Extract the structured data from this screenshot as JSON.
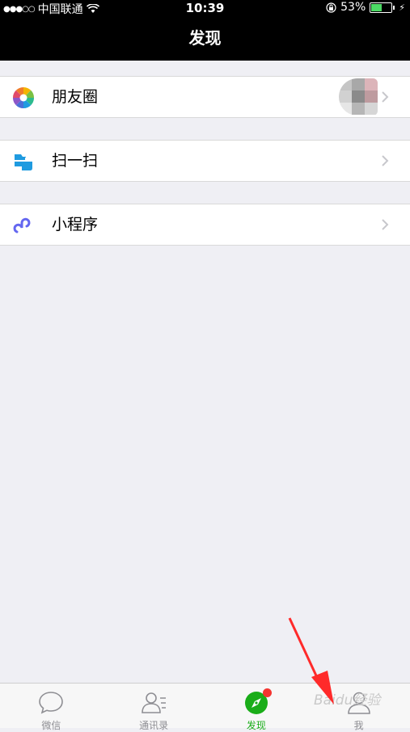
{
  "status": {
    "carrier": "中国联通",
    "time": "10:39",
    "battery_percent": "53%",
    "battery_level": 0.53
  },
  "nav": {
    "title": "发现"
  },
  "menu": {
    "moments": "朋友圈",
    "scan": "扫一扫",
    "mini_programs": "小程序"
  },
  "tabs": [
    {
      "label": "微信",
      "icon": "chat-bubble-icon"
    },
    {
      "label": "通讯录",
      "icon": "contacts-icon"
    },
    {
      "label": "发现",
      "icon": "compass-icon",
      "active": true
    },
    {
      "label": "我",
      "icon": "person-icon"
    }
  ],
  "watermark": "Baidu经验",
  "colors": {
    "accent": "#1aad19",
    "badge": "#f43530",
    "annotation_arrow": "#ff2a2a"
  }
}
